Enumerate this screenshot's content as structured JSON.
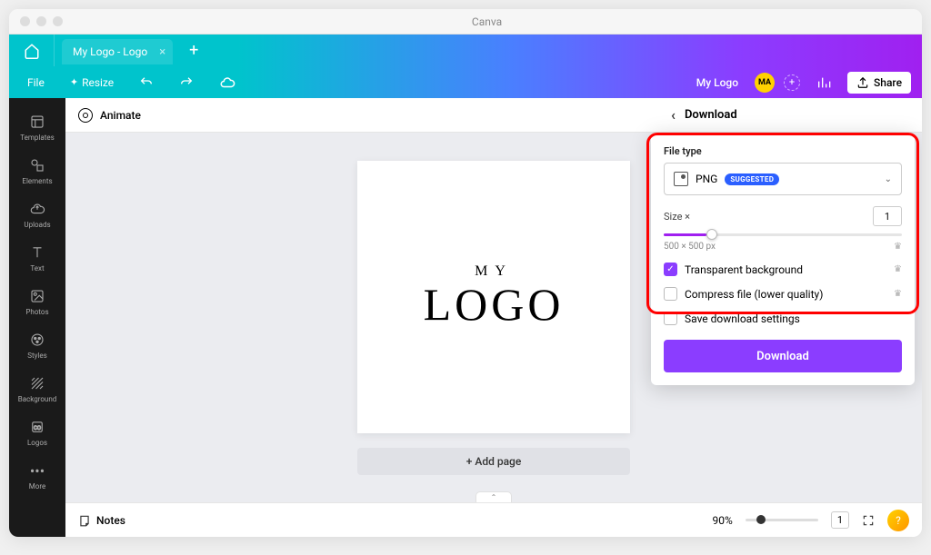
{
  "window": {
    "title": "Canva"
  },
  "tab": {
    "title": "My Logo - Logo"
  },
  "toolbar": {
    "file": "File",
    "resize": "Resize",
    "project_name": "My Logo",
    "avatar_initials": "MA",
    "share": "Share"
  },
  "context_bar": {
    "animate": "Animate"
  },
  "sidebar": {
    "items": [
      {
        "label": "Templates"
      },
      {
        "label": "Elements"
      },
      {
        "label": "Uploads"
      },
      {
        "label": "Text"
      },
      {
        "label": "Photos"
      },
      {
        "label": "Styles"
      },
      {
        "label": "Background"
      },
      {
        "label": "Logos"
      },
      {
        "label": "More"
      }
    ]
  },
  "canvas": {
    "logo_sub": "MY",
    "logo_main": "LOGO",
    "add_page": "+ Add page"
  },
  "footer": {
    "notes": "Notes",
    "zoom": "90%",
    "page_count": "1"
  },
  "download": {
    "title": "Download",
    "filetype_label": "File type",
    "filetype_value": "PNG",
    "badge": "SUGGESTED",
    "size_label": "Size ×",
    "size_value": "1",
    "dimensions": "500 × 500 px",
    "opt_transparent": "Transparent background",
    "opt_compress": "Compress file (lower quality)",
    "opt_save": "Save download settings",
    "button": "Download"
  }
}
